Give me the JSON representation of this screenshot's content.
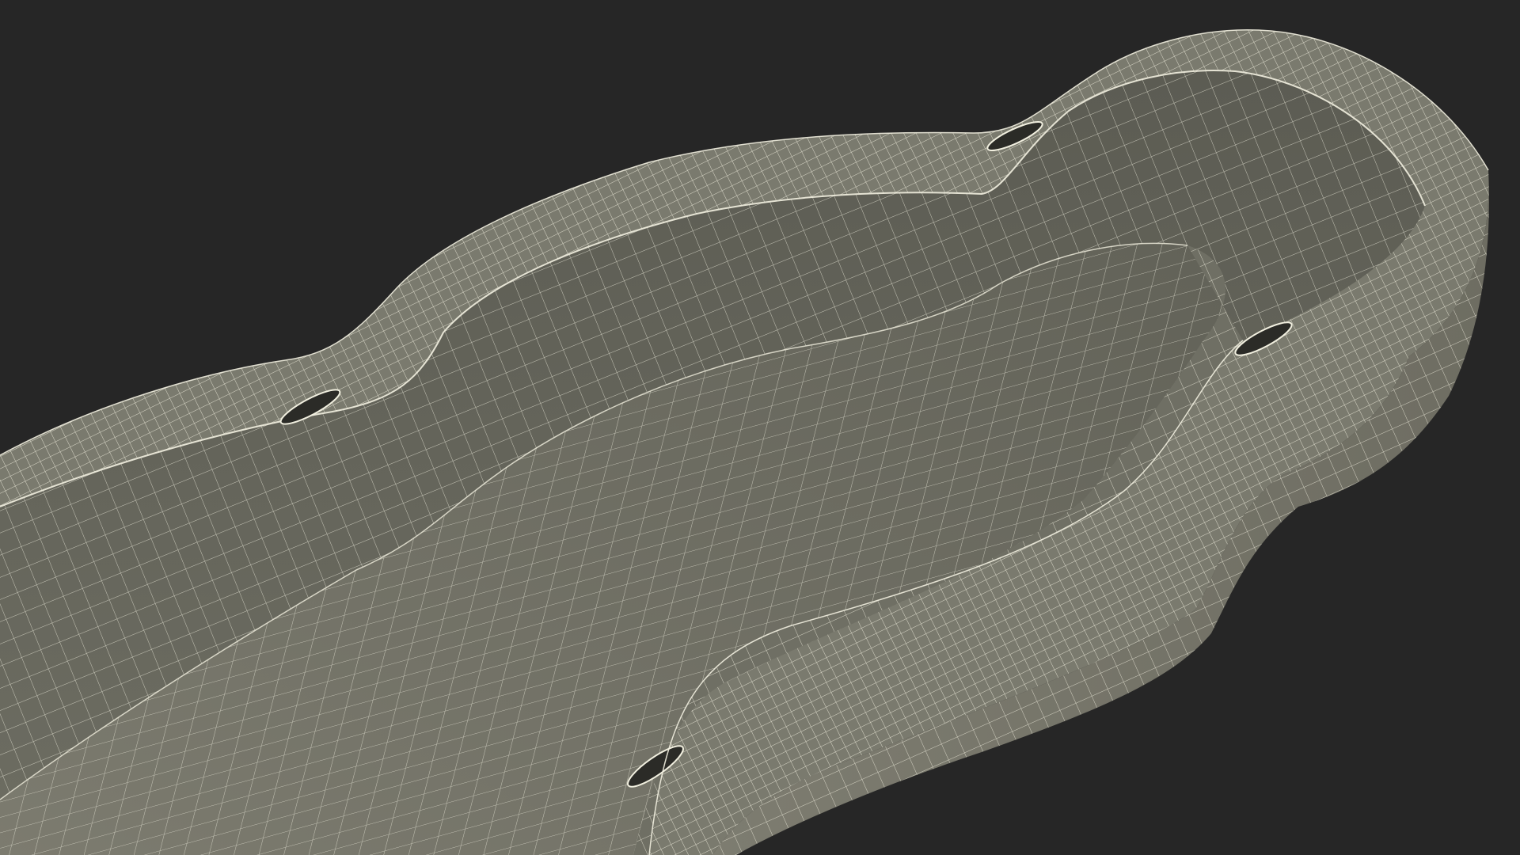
{
  "scene": {
    "subject": "wireframe-shell",
    "render_mode": "wireframe-over-shaded",
    "colors": {
      "background": "#262626",
      "wall_outer": "#7a7a6e",
      "wall_inner": "#67675d",
      "wall_shadow": "#55554c",
      "rim_top": "#8a897d",
      "floor": "#727266",
      "floor_far": "#66665c",
      "slot": "#2b2b27",
      "wire": "#f2f0e0"
    },
    "features": {
      "handle_slots": 4,
      "grid_density": "high"
    }
  }
}
